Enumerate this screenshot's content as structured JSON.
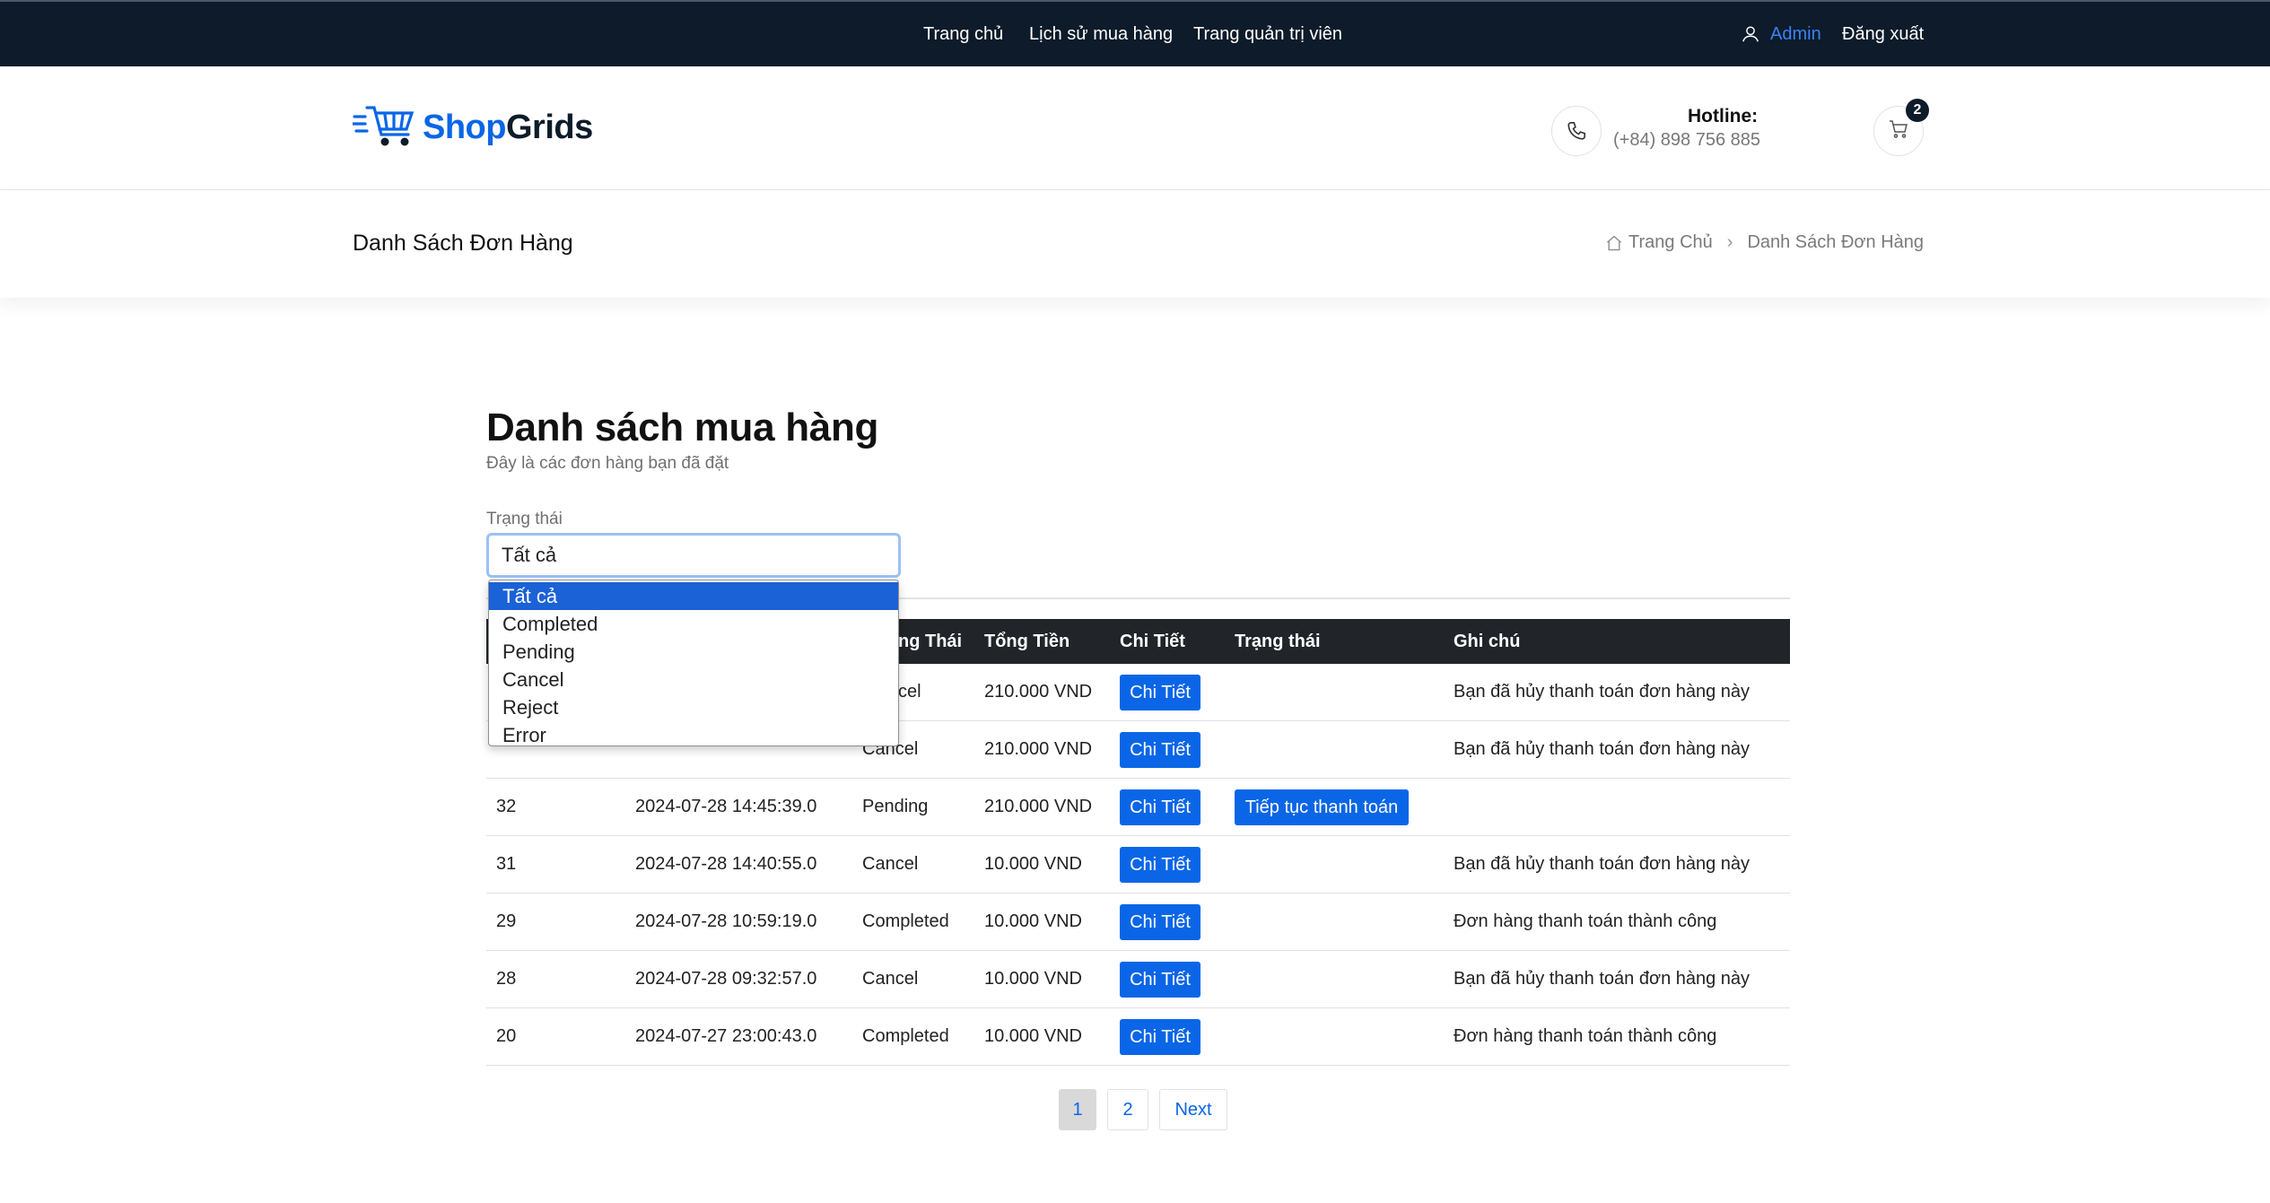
{
  "topbar": {
    "nav": [
      "Trang chủ",
      "Lịch sử mua hàng",
      "Trang quản trị viên"
    ],
    "user": "Admin",
    "logout": "Đăng xuất"
  },
  "header": {
    "logo_shop": "Shop",
    "logo_grids": "Grids",
    "hotline_label": "Hotline:",
    "hotline_number": "(+84) 898 756 885",
    "cart_count": "2"
  },
  "breadcrumb": {
    "page_title": "Danh Sách Đơn Hàng",
    "home": "Trang Chủ",
    "current": "Danh Sách Đơn Hàng"
  },
  "main": {
    "title": "Danh sách mua hàng",
    "subtitle": "Đây là các đơn hàng bạn đã đặt",
    "filter_label": "Trạng thái",
    "filter_value": "Tất cả",
    "filter_options": [
      "Tất cả",
      "Completed",
      "Pending",
      "Cancel",
      "Reject",
      "Error"
    ]
  },
  "table": {
    "headers": [
      "ng Thái",
      "Tổng Tiền",
      "Chi Tiết",
      "Trạng thái",
      "Ghi chú"
    ],
    "detail_label": "Chi Tiết",
    "continue_label": "Tiếp tục thanh toán",
    "rows": [
      {
        "id": "",
        "date": "",
        "status": "cel",
        "total": "210.000 VND",
        "note": "Bạn đã hủy thanh toán đơn hàng này"
      },
      {
        "id": "",
        "date": "",
        "status": "Cancel",
        "total": "210.000 VND",
        "note": "Bạn đã hủy thanh toán đơn hàng này"
      },
      {
        "id": "32",
        "date": "2024-07-28 14:45:39.0",
        "status": "Pending",
        "total": "210.000 VND",
        "note": ""
      },
      {
        "id": "31",
        "date": "2024-07-28 14:40:55.0",
        "status": "Cancel",
        "total": "10.000 VND",
        "note": "Bạn đã hủy thanh toán đơn hàng này"
      },
      {
        "id": "29",
        "date": "2024-07-28 10:59:19.0",
        "status": "Completed",
        "total": "10.000 VND",
        "note": "Đơn hàng thanh toán thành công"
      },
      {
        "id": "28",
        "date": "2024-07-28 09:32:57.0",
        "status": "Cancel",
        "total": "10.000 VND",
        "note": "Bạn đã hủy thanh toán đơn hàng này"
      },
      {
        "id": "20",
        "date": "2024-07-27 23:00:43.0",
        "status": "Completed",
        "total": "10.000 VND",
        "note": "Đơn hàng thanh toán thành công"
      }
    ]
  },
  "pagination": {
    "pages": [
      "1",
      "2"
    ],
    "next": "Next",
    "current": "1"
  },
  "colors": {
    "topbar_bg": "#0d1b2a",
    "accent": "#0a66e6",
    "table_header_bg": "#212529",
    "dropdown_selected": "#1a62d6"
  }
}
